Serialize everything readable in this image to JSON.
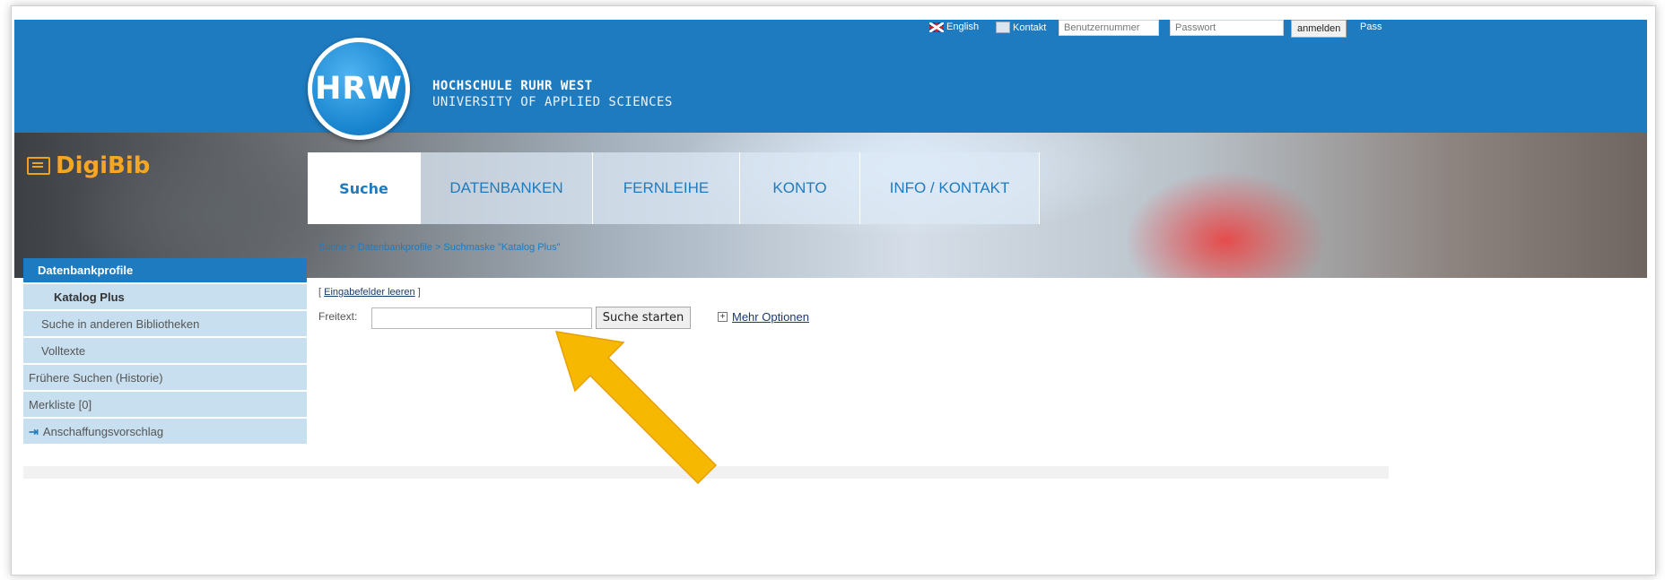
{
  "header": {
    "logo_abbr": "HRW",
    "logo_line1": "HOCHSCHULE RUHR WEST",
    "logo_line2": "UNIVERSITY OF APPLIED SCIENCES",
    "app_name": "DigiBib",
    "utility": {
      "english": "English",
      "kontakt": "Kontakt",
      "user_placeholder": "Benutzernummer",
      "pass_placeholder": "Passwort",
      "login_button": "anmelden",
      "truncated": "Pass"
    }
  },
  "tabs": [
    {
      "label": "Suche",
      "active": true
    },
    {
      "label": "DATENBANKEN",
      "active": false
    },
    {
      "label": "FERNLEIHE",
      "active": false
    },
    {
      "label": "KONTO",
      "active": false
    },
    {
      "label": "INFO / KONTAKT",
      "active": false
    }
  ],
  "breadcrumb": "Suche > Datenbankprofile > Suchmaske \"Katalog Plus\"",
  "sidebar": {
    "heading": "Datenbankprofile",
    "items": [
      {
        "label": "Katalog Plus"
      },
      {
        "label": "Suche in anderen Bibliotheken"
      },
      {
        "label": "Volltexte"
      },
      {
        "label": "Frühere Suchen (Historie)"
      },
      {
        "label": "Merkliste [0]"
      },
      {
        "label": "Anschaffungsvorschlag"
      }
    ]
  },
  "form": {
    "clear_prefix": "[",
    "clear_link": "Eingabefelder leeren",
    "clear_suffix": "]",
    "freitext_label": "Freitext:",
    "freitext_value": "",
    "search_button": "Suche starten",
    "more_options": "Mehr Optionen"
  },
  "colors": {
    "brand_blue": "#1f7bbf",
    "accent_orange": "#f5a623",
    "arrow_fill": "#f6b800"
  },
  "icons": {
    "uk_flag": "uk-flag-icon",
    "contact": "contact-icon",
    "login_arrow": "login-arrow-icon",
    "expand": "plus-box-icon",
    "annotation": "arrow-annotation-icon"
  }
}
